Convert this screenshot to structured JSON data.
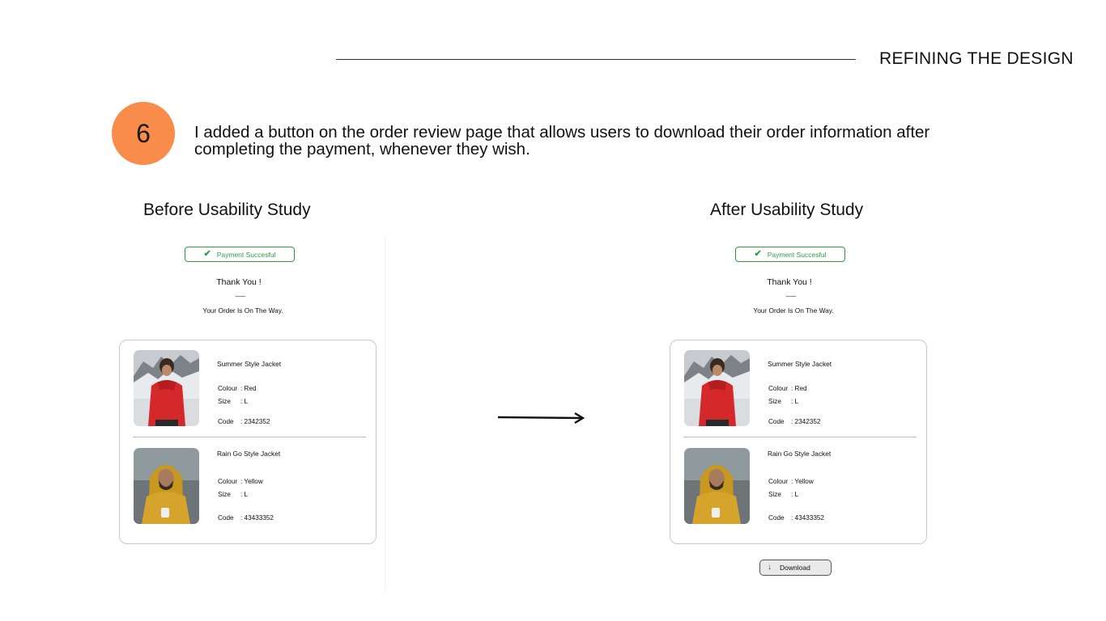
{
  "header": {
    "section_title": "REFINING THE DESIGN"
  },
  "step": {
    "number": "6",
    "text": "I added a button on the order review page that allows users to download their order information after completing the payment, whenever they wish."
  },
  "columns": {
    "before": "Before Usability Study",
    "after": "After Usability Study"
  },
  "screen": {
    "payment_badge": "Payment Succesful",
    "thank_you": "Thank  You !",
    "order_status": "Your Order Is On The Way.",
    "labels": {
      "colour": "Colour",
      "size": "Size",
      "code": "Code"
    },
    "items": [
      {
        "name": "Summer Style Jacket",
        "colour": ": Red",
        "size": ": L",
        "code": ": 2342352"
      },
      {
        "name": "Rain Go Style Jacket",
        "colour": ": Yellow",
        "size": ": L",
        "code": ": 43433352"
      }
    ],
    "download_label": "Download"
  },
  "icons": {
    "badge": "check-icon",
    "download": "download-arrow-icon",
    "transition": "right-arrow-icon"
  },
  "colors": {
    "accent": "#f98c4a",
    "success": "#2e9e44"
  }
}
